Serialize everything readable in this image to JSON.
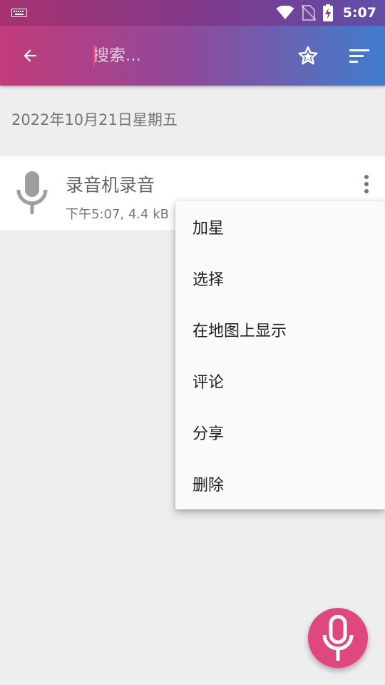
{
  "status_bar": {
    "time": "5:07",
    "icons": [
      "keyboard-icon",
      "wifi-icon",
      "no-sim-icon",
      "battery-charging-icon"
    ]
  },
  "app_bar": {
    "search_placeholder": "搜索...",
    "icons": [
      "arrow-back-icon",
      "star-icon",
      "sort-icon"
    ]
  },
  "list": {
    "date_header": "2022年10月21日星期五",
    "items": [
      {
        "title": "录音机录音",
        "meta": "下午5:07, 4.4 kB",
        "icon": "microphone-icon"
      }
    ]
  },
  "context_menu": {
    "items": [
      "加星",
      "选择",
      "在地图上显示",
      "评论",
      "分享",
      "删除"
    ]
  },
  "fab": {
    "icon": "microphone-icon"
  },
  "colors": {
    "accent": "#e0467f",
    "appbar_start": "#c23b7a",
    "appbar_end": "#3f7dcc"
  }
}
